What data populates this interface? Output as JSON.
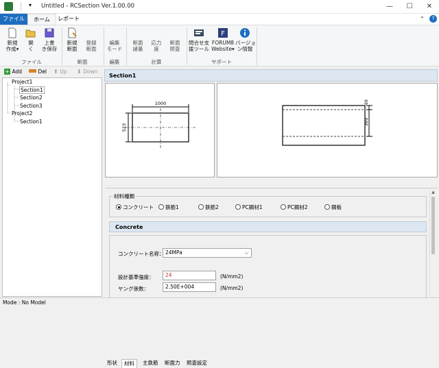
{
  "window": {
    "title": "Untitled - RCSection Ver.1.00.00",
    "minimize": "—",
    "maximize": "☐",
    "close": "✕"
  },
  "ribbon_tabs": {
    "file": "ファイル",
    "home": "ホーム",
    "report": "レポート"
  },
  "ribbon": {
    "new_create": "新規\n作成▾",
    "open": "開\nく",
    "overwrite_save": "上書\nき保存",
    "file_group": "ファイル",
    "new_section": "新規\n断面",
    "register_section": "登録\n断面",
    "section_group": "断面",
    "edit_mode": "編集\nモード",
    "edit_group": "編集",
    "section_check": "断面\n諸量",
    "stress_calc": "応力\n度",
    "section_verify": "断面\n照査",
    "calc_group": "計算",
    "support_tool": "問合せ支\n援ツール",
    "forum8_website": "FORUM8\nWebsite▾",
    "version_info": "バージョ\nン情報",
    "support_group": "サポート"
  },
  "tree_toolbar": {
    "add": "Add",
    "del": "Del",
    "up": "Up",
    "down": "Down"
  },
  "tree": {
    "project1": "Project1",
    "section1": "Section1",
    "section2": "Section2",
    "section3": "Section3",
    "project2": "Project2",
    "p2_section1": "Section1"
  },
  "section_header": "Section1",
  "drawing": {
    "width_dim": "1000",
    "height_dim": "523",
    "right_dim_top": "69",
    "right_dim_main": "369"
  },
  "prop_tabs": [
    "形状",
    "材料",
    "主鉄筋",
    "断面力",
    "照査設定"
  ],
  "material": {
    "group_label": "材料種類",
    "options": [
      "コンクリート",
      "鉄筋1",
      "鉄筋2",
      "PC鋼材1",
      "PC鋼材2",
      "鋼板"
    ],
    "concrete_header": "Concrete",
    "name_label": "コンクリート名称：",
    "name_value": "24MPa",
    "strength_label": "設計基準強度：",
    "strength_value": "24",
    "strength_unit": "(N/mm2)",
    "young_label": "ヤング係数：",
    "young_value": "2.50E+004",
    "young_unit": "(N/mm2)"
  },
  "status": {
    "mode": "Mode : No Model"
  },
  "colors": {
    "accent": "#1e6ebf",
    "header": "#dce7f2",
    "strength_value": "#c03030"
  }
}
